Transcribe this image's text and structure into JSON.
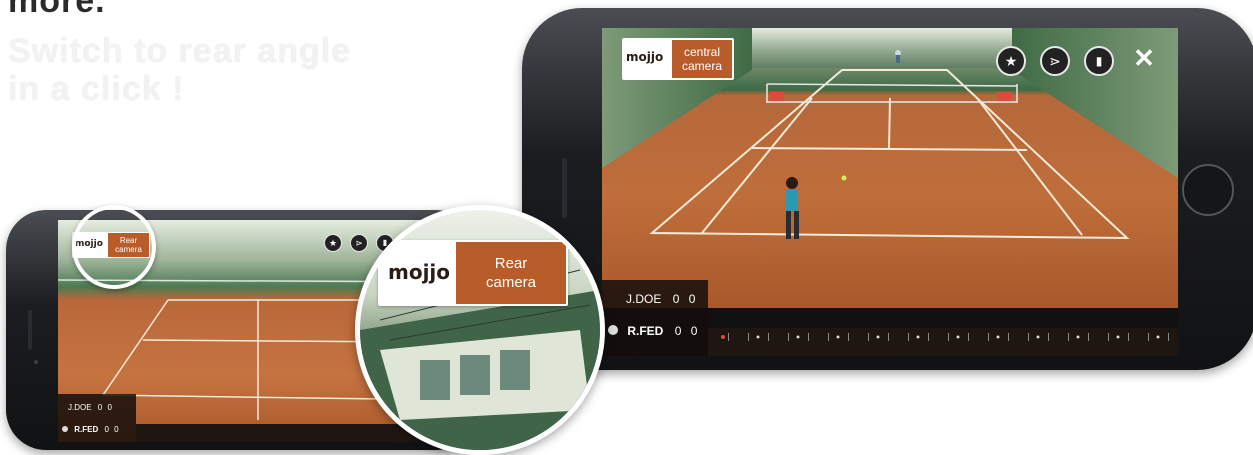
{
  "headline": {
    "top_fragment": "more.",
    "line1": "Switch to rear angle",
    "line2": "in a click !"
  },
  "main_phone": {
    "logo": "mojjo",
    "camera_button": "central camera",
    "score": {
      "player1": {
        "name": "J.DOE",
        "s1": "0",
        "s2": "0"
      },
      "player2": {
        "name": "R.FED",
        "s1": "0",
        "s2": "0"
      }
    },
    "icons": [
      "star-icon",
      "share-icon",
      "comment-icon",
      "close-icon"
    ],
    "close_glyph": "✕"
  },
  "small_phone": {
    "logo": "mojjo",
    "camera_button": "Rear camera",
    "score": {
      "player1": {
        "name": "J.DOE",
        "s1": "0",
        "s2": "0"
      },
      "player2": {
        "name": "R.FED",
        "s1": "0",
        "s2": "0"
      }
    }
  },
  "zoom_bubble": {
    "logo": "mojjo",
    "camera_button": "Rear camera"
  },
  "colors": {
    "brand_orange": "#b85c2a",
    "clay": "#bf6e3a",
    "dark": "#1e1611"
  }
}
